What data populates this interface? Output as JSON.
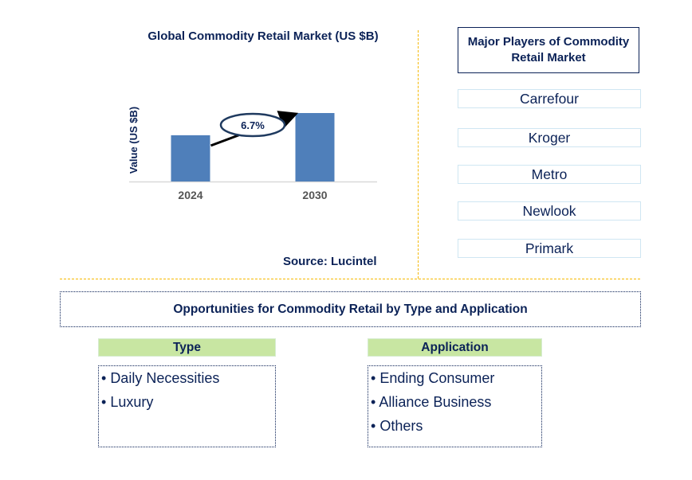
{
  "chart_data": {
    "type": "bar",
    "title": "Global Commodity Retail Market (US $B)",
    "xlabel": "",
    "ylabel": "Value (US $B)",
    "categories": [
      "2024",
      "2030"
    ],
    "values": [
      1.0,
      1.48
    ],
    "value_units": "relative (no axis ticks shown)",
    "annotation": {
      "label": "6.7%",
      "meaning": "CAGR 2024-2030",
      "from": "2024",
      "to": "2030"
    },
    "grid": false,
    "legend": "none",
    "bar_color": "#4f7fba"
  },
  "source": "Source: Lucintel",
  "players": {
    "title": "Major Players of Commodity Retail Market",
    "items": [
      "Carrefour",
      "Kroger",
      "Metro",
      "Newlook",
      "Primark"
    ]
  },
  "opportunities": {
    "title": "Opportunities for Commodity Retail by Type and Application",
    "type": {
      "header": "Type",
      "items": [
        "Daily Necessities",
        "Luxury"
      ]
    },
    "application": {
      "header": "Application",
      "items": [
        "Ending Consumer",
        "Alliance Business",
        "Others"
      ]
    }
  },
  "colors": {
    "navy": "#0b2257",
    "bar": "#4f7fba",
    "divider": "#f5b800",
    "category_header": "#c8e6a2",
    "player_border": "#cfe6f2"
  }
}
